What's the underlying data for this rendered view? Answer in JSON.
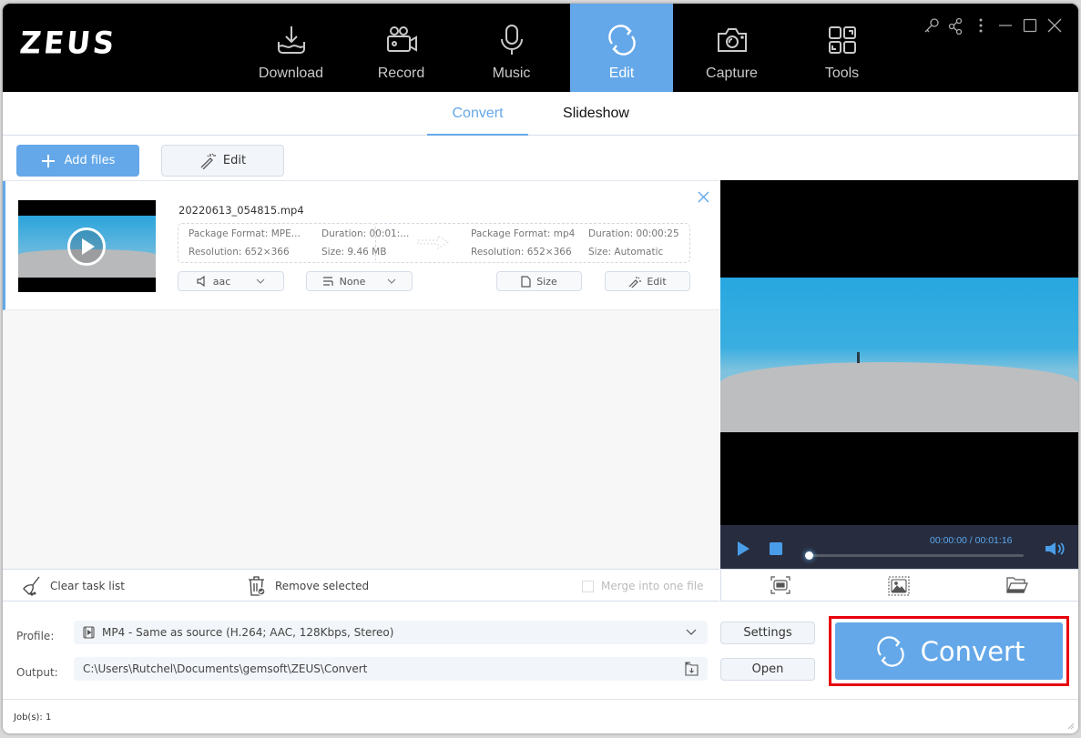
{
  "app": {
    "logo": "ZEUS"
  },
  "nav": [
    {
      "label": "Download",
      "icon": "download-icon"
    },
    {
      "label": "Record",
      "icon": "video-camera-icon"
    },
    {
      "label": "Music",
      "icon": "microphone-icon"
    },
    {
      "label": "Edit",
      "icon": "convert-cycle-icon",
      "active": true
    },
    {
      "label": "Capture",
      "icon": "camera-icon"
    },
    {
      "label": "Tools",
      "icon": "tools-grid-icon"
    }
  ],
  "window_controls": [
    "key-icon",
    "share-icon",
    "more-icon",
    "minimize-icon",
    "maximize-icon",
    "close-icon"
  ],
  "subtabs": [
    {
      "label": "Convert",
      "active": true
    },
    {
      "label": "Slideshow",
      "active": false
    }
  ],
  "toolbar": {
    "add_files": "Add files",
    "edit": "Edit"
  },
  "file": {
    "name": "20220613_054815.mp4",
    "source": {
      "package_format": "Package Format: MPE...",
      "duration": "Duration:  00:01:...",
      "resolution": "Resolution: 652×366",
      "size": "Size: 9.46 MB"
    },
    "target": {
      "package_format": "Package Format: mp4",
      "duration": "Duration: 00:00:25",
      "resolution": "Resolution: 652×366",
      "size": "Size: Automatic"
    },
    "audio_select": "aac",
    "subtitle_select": "None",
    "size_button": "Size",
    "edit_button": "Edit"
  },
  "listbar": {
    "clear": "Clear task list",
    "remove": "Remove selected",
    "merge": "Merge into one file",
    "merge_checked": false
  },
  "player": {
    "time": "00:00:00 / 00:01:16",
    "progress": 0
  },
  "bottom": {
    "profile_label": "Profile:",
    "profile_value": "MP4 - Same as source (H.264; AAC, 128Kbps, Stereo)",
    "output_label": "Output:",
    "output_value": "C:\\Users\\Rutchel\\Documents\\gemsoft\\ZEUS\\Convert",
    "settings": "Settings",
    "open": "Open",
    "convert": "Convert"
  },
  "status": {
    "jobs": "Job(s): 1"
  },
  "colors": {
    "accent": "#64a8e9",
    "highlight": "#e8000b",
    "topbar": "#000000",
    "player": "#272d3f"
  }
}
